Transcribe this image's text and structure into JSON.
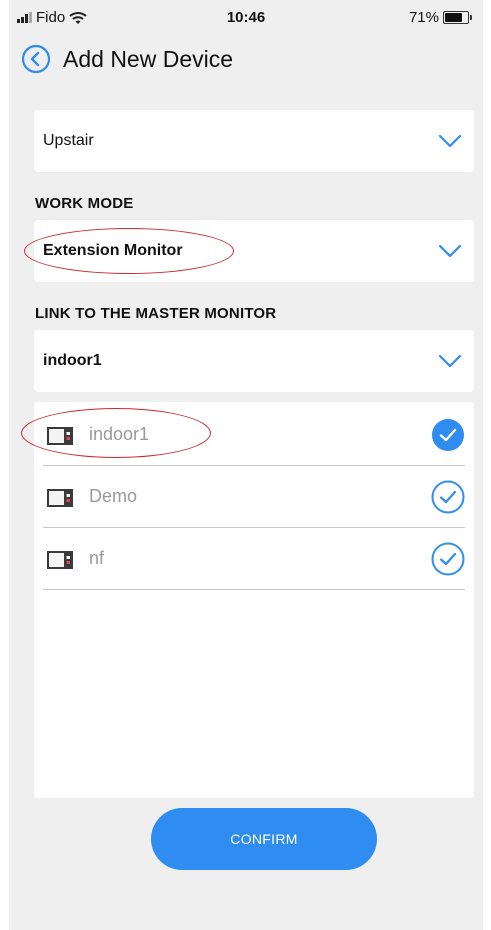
{
  "status_bar": {
    "carrier": "Fido",
    "time": "10:46",
    "battery_percent": "71%",
    "battery_level": 0.71
  },
  "header": {
    "back_icon": "chevron-left-circle-icon",
    "title": "Add New Device"
  },
  "location_select": {
    "value": "Upstair",
    "icon": "chevron-down-icon"
  },
  "work_mode": {
    "label": "WORK MODE",
    "value": "Extension Monitor",
    "icon": "chevron-down-icon"
  },
  "master_monitor": {
    "label": "LINK TO THE MASTER MONITOR",
    "value": "indoor1",
    "icon": "chevron-down-icon"
  },
  "devices": [
    {
      "name": "indoor1",
      "checked": true,
      "icon": "monitor-icon"
    },
    {
      "name": "Demo",
      "checked": false,
      "icon": "monitor-icon"
    },
    {
      "name": "nf",
      "checked": false,
      "icon": "monitor-icon"
    }
  ],
  "confirm": {
    "label": "CONFIRM"
  },
  "colors": {
    "accent": "#2f8cf0",
    "background": "#efefef",
    "annotation_red": "#c9292f"
  }
}
